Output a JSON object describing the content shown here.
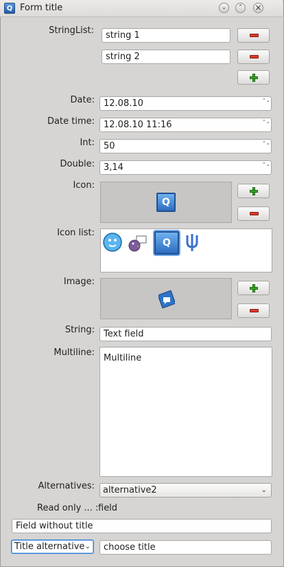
{
  "window": {
    "title": "Form title",
    "app_icon_letter": "Q",
    "minimize_glyph": "⌄",
    "maximize_glyph": "⌃"
  },
  "fields": {
    "stringlist": {
      "label": "StringList:",
      "items": [
        "string 1",
        "string 2"
      ]
    },
    "date": {
      "label": "Date:",
      "value": "12.08.10"
    },
    "datetime": {
      "label": "Date time:",
      "value": "12.08.10 11:16"
    },
    "int": {
      "label": "Int:",
      "value": "50"
    },
    "double": {
      "label": "Double:",
      "value": "3,14"
    },
    "icon": {
      "label": "Icon:",
      "icon_name": "qt-icon"
    },
    "iconlist": {
      "label": "Icon list:",
      "icons": [
        "smiley-bubble-icon",
        "pidgin-bird-icon",
        "qt-icon",
        "psi-icon"
      ]
    },
    "image": {
      "label": "Image:",
      "image_name": "chat-bubble-image"
    },
    "string": {
      "label": "String:",
      "value": "Text field"
    },
    "multiline": {
      "label": "Multiline:",
      "value": "Multiline"
    },
    "alternatives": {
      "label": "Alternatives:",
      "value": "alternative2"
    },
    "readonly": {
      "label": "Read only ... :",
      "value": "field"
    },
    "field_without_title": {
      "value": "Field without title"
    },
    "title_alternative": {
      "selected": "Title alternative",
      "field_value": "choose title"
    }
  },
  "icons": {
    "spin_arrows": "⌃⌄",
    "chevron": "⌄",
    "qt_letter": "Q"
  }
}
